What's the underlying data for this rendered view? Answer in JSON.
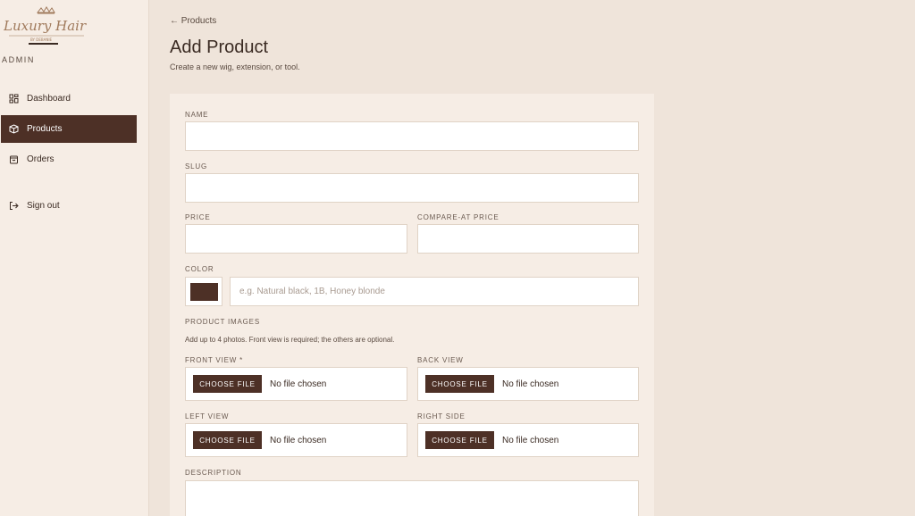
{
  "sidebar": {
    "brand": "Luxury Hair",
    "admin_label": "ADMIN",
    "items": [
      {
        "label": "Dashboard",
        "icon": "grid-icon"
      },
      {
        "label": "Products",
        "icon": "box-icon",
        "active": true
      },
      {
        "label": "Orders",
        "icon": "bag-icon"
      }
    ],
    "sign_out": "Sign out"
  },
  "header": {
    "back_label": "← Products",
    "title": "Add Product",
    "subtitle": "Create a new wig, extension, or tool."
  },
  "form": {
    "name_label": "NAME",
    "slug_label": "SLUG",
    "price_label": "PRICE",
    "compare_label": "COMPARE-AT PRICE",
    "color_label": "COLOR",
    "color_value": "#4d3026",
    "color_placeholder": "e.g. Natural black, 1B, Honey blonde",
    "images_label": "PRODUCT IMAGES",
    "images_help": "Add up to 4 photos. Front view is required; the others are optional.",
    "front_label": "FRONT VIEW *",
    "back_label": "BACK VIEW",
    "left_label": "LEFT VIEW",
    "right_label": "RIGHT SIDE",
    "choose_file": "CHOOSE FILE",
    "no_file": "No file chosen",
    "description_label": "DESCRIPTION"
  },
  "colors": {
    "accent": "#4d3026",
    "background": "#efe4da",
    "sidebar": "#f6ede5"
  }
}
